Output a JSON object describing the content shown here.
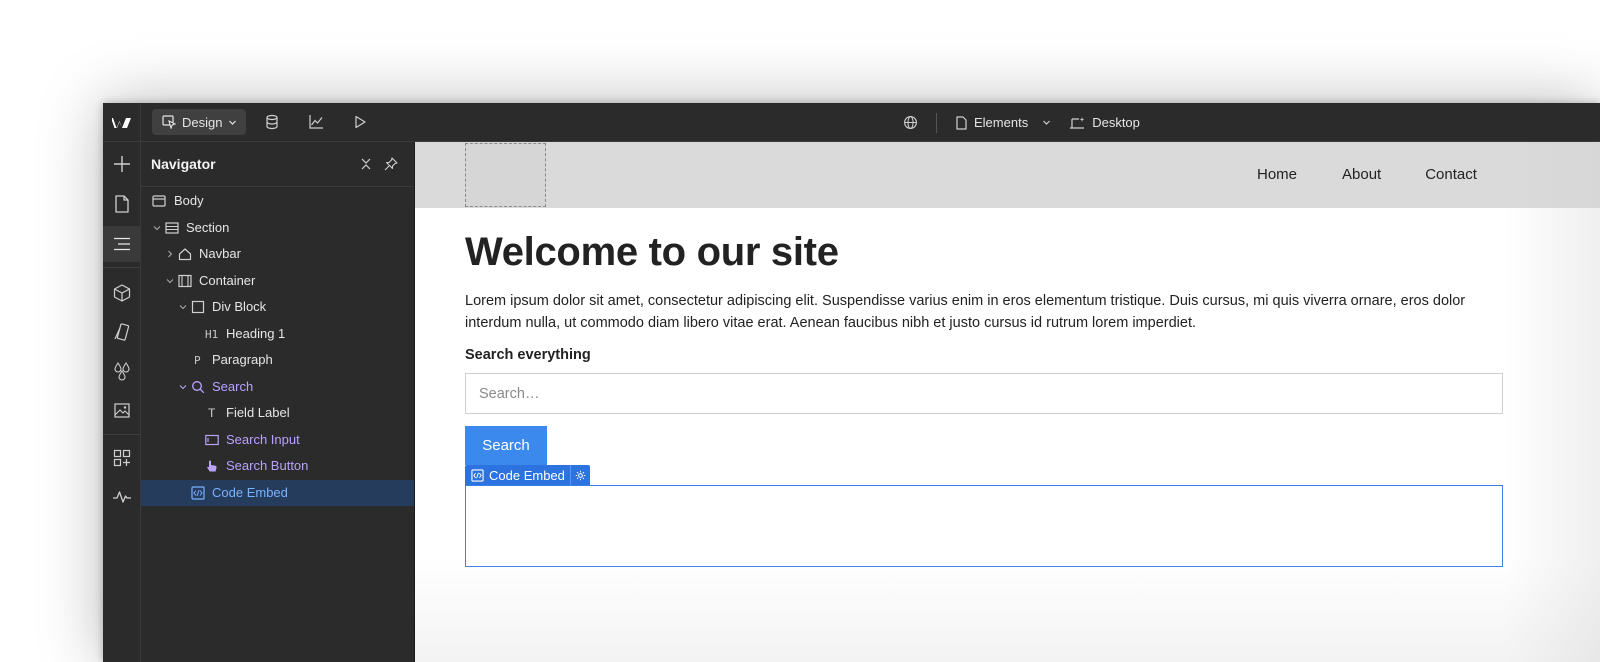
{
  "topbar": {
    "logo": "W",
    "mode_label": "Design",
    "page_label": "Elements",
    "breakpoint_label": "Desktop",
    "icons": [
      "database-icon",
      "chart-icon",
      "play-icon",
      "globe-icon",
      "page-icon",
      "chevron-down-icon",
      "desktop-breakpoint-icon"
    ]
  },
  "rail": {
    "items": [
      "add-icon",
      "pages-icon",
      "navigator-icon",
      "components-icon",
      "style-selectors-icon",
      "variables-icon",
      "assets-icon",
      "apps-icon",
      "audit-icon"
    ],
    "active": "navigator-icon"
  },
  "navigator": {
    "title": "Navigator",
    "tree": [
      {
        "label": "Body",
        "icon": "body-icon"
      },
      {
        "label": "Section",
        "icon": "section-icon"
      },
      {
        "label": "Navbar",
        "icon": "navbar-icon"
      },
      {
        "label": "Container",
        "icon": "container-icon"
      },
      {
        "label": "Div Block",
        "icon": "div-block-icon"
      },
      {
        "label": "Heading 1",
        "icon": "heading-icon",
        "icon_text": "H1"
      },
      {
        "label": "Paragraph",
        "icon": "paragraph-icon",
        "icon_text": "P"
      },
      {
        "label": "Search",
        "icon": "search-icon"
      },
      {
        "label": "Field Label",
        "icon": "text-icon",
        "icon_text": "T"
      },
      {
        "label": "Search Input",
        "icon": "input-icon"
      },
      {
        "label": "Search Button",
        "icon": "pointer-icon"
      },
      {
        "label": "Code Embed",
        "icon": "code-embed-icon"
      }
    ],
    "selected": "Code Embed",
    "colors": {
      "component": "#b9a3ff",
      "selected_text": "#7ab2ff",
      "selected_bg": "#263c5c"
    }
  },
  "canvas": {
    "nav_links": [
      "Home",
      "About",
      "Contact"
    ],
    "heading": "Welcome to our site",
    "paragraph": "Lorem ipsum dolor sit amet, consectetur adipiscing elit. Suspendisse varius enim in eros elementum tristique. Duis cursus, mi quis viverra ornare, eros dolor interdum nulla, ut commodo diam libero vitae erat. Aenean faucibus nibh et justo cursus id rutrum lorem imperdiet.",
    "field_label": "Search everything",
    "search_placeholder": "Search…",
    "search_button": "Search",
    "embed_tag": "Code Embed",
    "colors": {
      "button": "#3b89ec",
      "selection": "#2d73e0",
      "navbar_bg": "#dadada"
    }
  }
}
